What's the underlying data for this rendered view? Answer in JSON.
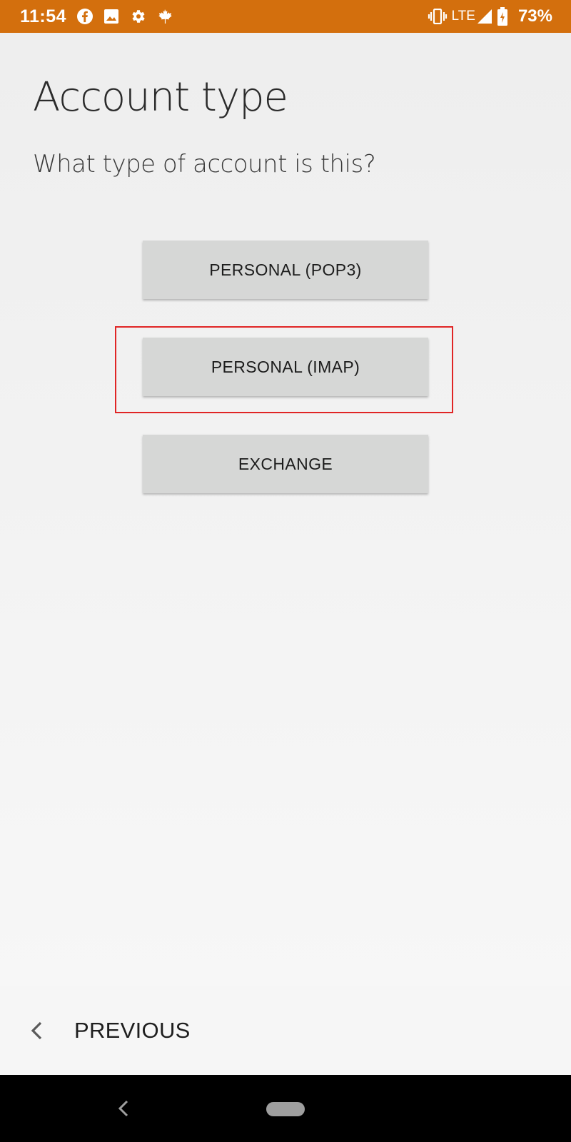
{
  "status_bar": {
    "time": "11:54",
    "network": "LTE",
    "battery": "73%",
    "icons": [
      "facebook-icon",
      "image-icon",
      "settings-icon",
      "maple-leaf-icon",
      "vibrate-icon",
      "signal-icon",
      "battery-charging-icon"
    ],
    "background_color": "#d36f0d"
  },
  "page": {
    "title": "Account type",
    "subtitle": "What type of account is this?"
  },
  "options": {
    "pop3": "PERSONAL (POP3)",
    "imap": "PERSONAL (IMAP)",
    "exchange": "EXCHANGE"
  },
  "highlight": {
    "target": "imap",
    "color": "#e02525"
  },
  "bottom_bar": {
    "previous_label": "PREVIOUS"
  }
}
